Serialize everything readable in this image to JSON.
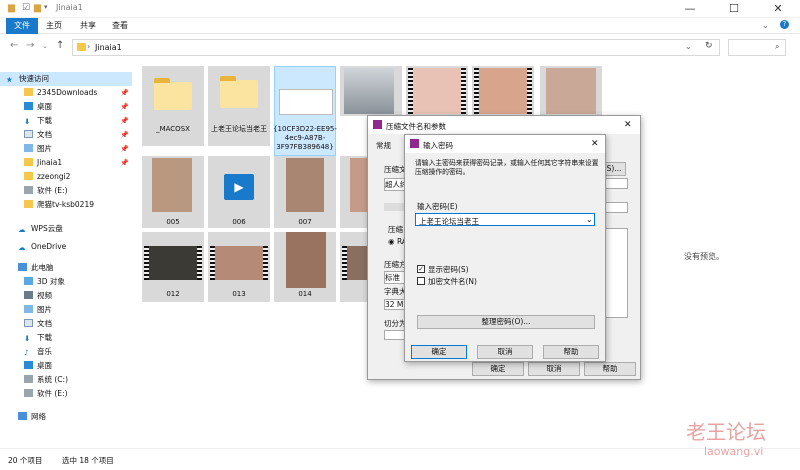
{
  "window": {
    "title": "Jinaia1",
    "minimize": "—",
    "maximize": "☐",
    "close": "✕",
    "help": "?"
  },
  "ribbon": {
    "tabs": [
      "文件",
      "主页",
      "共享",
      "查看"
    ]
  },
  "address": {
    "path": "Jinaia1",
    "sep": "›"
  },
  "sidebar": {
    "quick_access": "快速访问",
    "pinned": [
      "2345Downloads",
      "桌面",
      "下载",
      "文档",
      "图片",
      "Jinaia1"
    ],
    "recent": [
      "zzeongi2",
      "软件 (E:)",
      "爬猫tv-ksb0219"
    ],
    "wps": "WPS云盘",
    "onedrive": "OneDrive",
    "this_pc": "此电脑",
    "pc_items": [
      "3D 对象",
      "视频",
      "图片",
      "文档",
      "下载",
      "音乐",
      "桌面",
      "系统 (C:)",
      "软件 (E:)"
    ],
    "network": "网络"
  },
  "files": {
    "macosx": "_MACOSX",
    "folder2": "上老王论坛当老王",
    "guid": "{10CF3D22-EE95-4ec9-A87B-3F97FB389648}",
    "n005": "005",
    "n006": "006",
    "n007": "007",
    "n012": "012",
    "n013": "013",
    "n014": "014"
  },
  "preview": {
    "text": "没有预览。"
  },
  "status": {
    "count": "20 个项目",
    "selected": "选中 18 个项目"
  },
  "archive_dialog": {
    "title": "压缩文件名和参数",
    "tab_general": "常规",
    "lbl_archive": "压缩文",
    "combo": "超人终",
    "lbl_format": "压缩",
    "radio": "RA",
    "lbl_method": "压缩方",
    "method": "标准",
    "lbl_dict": "字典大",
    "dict": "32 MB",
    "lbl_split": "切分为",
    "btn_browse": "S)...",
    "ok": "确定",
    "cancel": "取消",
    "help": "帮助"
  },
  "password_dialog": {
    "title": "输入密码",
    "desc": "请输入主密码来获得密码记录，或输入任何其它字符串来设置压缩操作的密码。",
    "field_label": "输入密码(E)",
    "value": "上老王论坛当老王",
    "show_password": "显示密码(S)",
    "encrypt_names": "加密文件名(N)",
    "organize": "整理密码(O)...",
    "ok": "确定",
    "cancel": "取消",
    "help": "帮助"
  },
  "watermark": {
    "text": "老王论坛",
    "url": "laowang.vi"
  },
  "colors": {
    "accent": "#1979ca",
    "folder": "#f5c84c",
    "selected": "#cce8ff"
  }
}
